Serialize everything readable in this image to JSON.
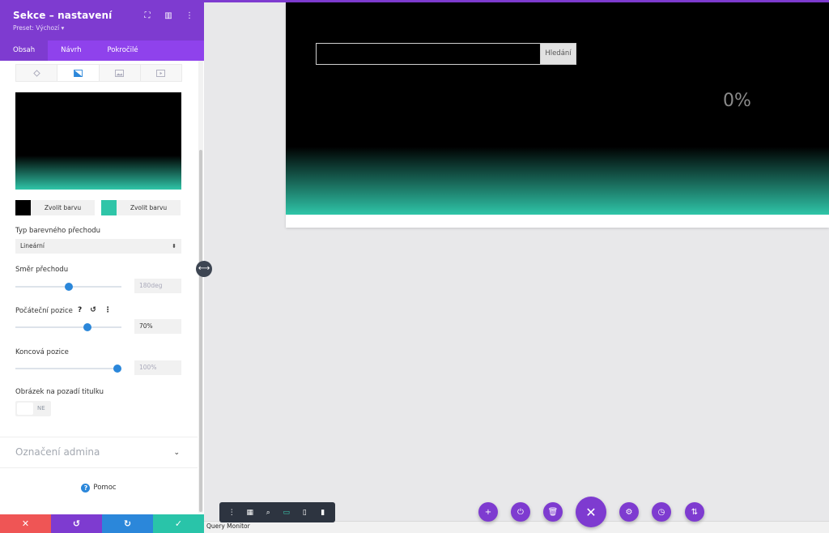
{
  "panel": {
    "title": "Sekce – nastavení",
    "preset": "Preset: Výchozí ▾",
    "header_icons": [
      "focus-icon",
      "columns-icon",
      "more-vertical-icon"
    ],
    "tabs": [
      {
        "label": "Obsah",
        "active": true
      },
      {
        "label": "Návrh",
        "active": false
      },
      {
        "label": "Pokročilé",
        "active": false
      }
    ],
    "subtabs": [
      "paint-bucket-icon",
      "gradient-icon",
      "image-icon",
      "video-icon"
    ],
    "gradient": {
      "start_color": "#000000",
      "end_color": "#2fc5a8"
    },
    "color_picker_1": {
      "label": "Zvolit barvu",
      "color": "#000000"
    },
    "color_picker_2": {
      "label": "Zvolit barvu",
      "color": "#2fc5a8"
    },
    "gradient_type": {
      "label": "Typ barevného přechodu",
      "value": "Lineární"
    },
    "direction": {
      "label": "Směr přechodu",
      "value": "180deg",
      "fraction": 0.5
    },
    "start_position": {
      "label": "Počáteční pozice",
      "value": "70%",
      "fraction": 0.68
    },
    "end_position": {
      "label": "Koncová pozice",
      "value": "100%",
      "fraction": 0.96
    },
    "title_bg_image": {
      "label": "Obrázek na pozadí titulku",
      "toggle_value": "NE"
    },
    "admin_label": {
      "title": "Označení admina"
    },
    "help": {
      "label": "Pomoc"
    }
  },
  "action_bar": [
    {
      "name": "close-icon",
      "symbol": "✕",
      "color": "#ef5555"
    },
    {
      "name": "undo-icon",
      "symbol": "↺",
      "color": "#7e3bd0"
    },
    {
      "name": "redo-icon",
      "symbol": "↻",
      "color": "#2b87da"
    },
    {
      "name": "check-icon",
      "symbol": "✓",
      "color": "#29c4a9"
    }
  ],
  "preview": {
    "search_placeholder": "",
    "search_button": "Hledání",
    "progress_text": "0%"
  },
  "status_bar": {
    "label": "Query Monitor"
  },
  "view_toolbar": [
    "more-vertical-icon",
    "wireframe-icon",
    "zoom-icon",
    "desktop-icon",
    "tablet-icon",
    "phone-icon"
  ],
  "colors": {
    "brand_purple": "#7e3bd0",
    "accent_teal": "#2fc5a8",
    "link_blue": "#2b87da"
  }
}
